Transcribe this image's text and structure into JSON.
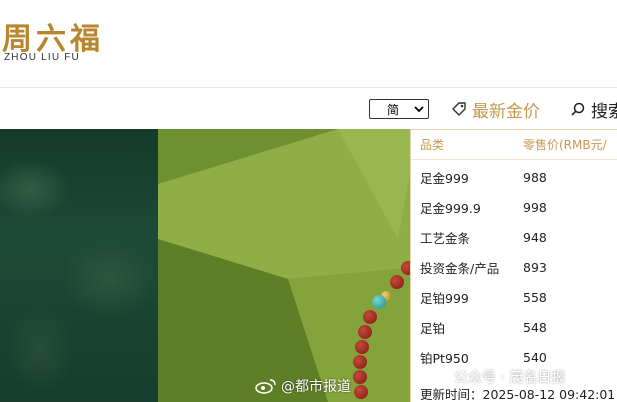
{
  "brand": {
    "logo_cn": "周六福",
    "logo_en": "ZHOU LIU FU"
  },
  "toolbar": {
    "language_selected": "简",
    "gold_price_label": "最新金价",
    "search_label": "搜索"
  },
  "price_panel": {
    "headers": {
      "category": "品类",
      "price": "零售价(RMB元/"
    },
    "rows": [
      {
        "name": "足金999",
        "price": "988"
      },
      {
        "name": "足金999.9",
        "price": "998"
      },
      {
        "name": "工艺金条",
        "price": "948"
      },
      {
        "name": "投资金条/产品",
        "price": "893"
      },
      {
        "name": "足铂999",
        "price": "558"
      },
      {
        "name": "足铂",
        "price": "548"
      },
      {
        "name": "铂Pt950",
        "price": "540"
      }
    ],
    "update_label": "更新时间：2025-08-12 09:42:01"
  },
  "watermarks": {
    "weibo": "@都市报道",
    "wechat": "公众号 · 茂名日报"
  },
  "colors": {
    "accent_gold": "#c89a50",
    "logo_gold": "#b8862e",
    "hero_green": "#6f9030"
  },
  "icons": {
    "select": "chevron-down-icon",
    "price": "tag-icon",
    "search": "search-icon",
    "weibo": "weibo-icon",
    "wechat": "wechat-icon"
  }
}
